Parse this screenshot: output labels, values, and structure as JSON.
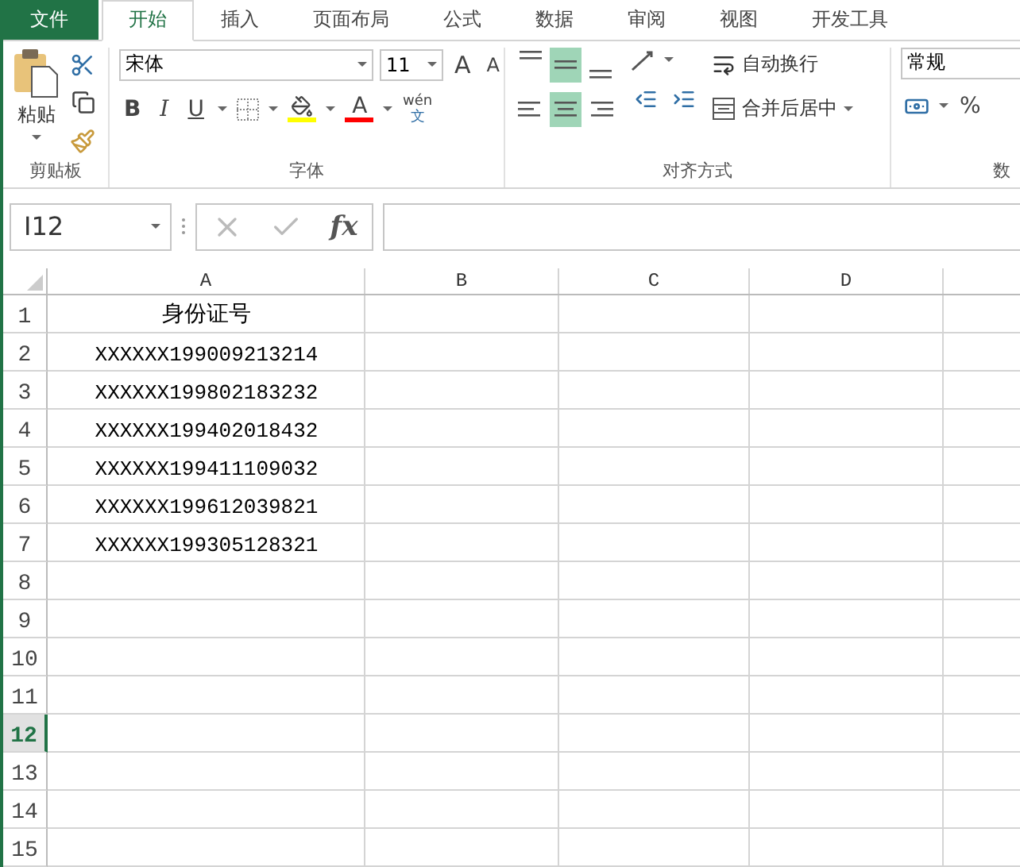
{
  "tabs": [
    {
      "label": "文件",
      "kind": "file",
      "selected": false
    },
    {
      "label": "开始",
      "kind": "tab",
      "selected": true
    },
    {
      "label": "插入",
      "kind": "tab",
      "selected": false
    },
    {
      "label": "页面布局",
      "kind": "tab",
      "selected": false
    },
    {
      "label": "公式",
      "kind": "tab",
      "selected": false
    },
    {
      "label": "数据",
      "kind": "tab",
      "selected": false
    },
    {
      "label": "审阅",
      "kind": "tab",
      "selected": false
    },
    {
      "label": "视图",
      "kind": "tab",
      "selected": false
    },
    {
      "label": "开发工具",
      "kind": "tab",
      "selected": false
    }
  ],
  "ribbon": {
    "clipboard": {
      "paste_label": "粘贴",
      "group_label": "剪贴板"
    },
    "font": {
      "font_name": "宋体",
      "font_size": "11",
      "grow": "A",
      "shrink": "A",
      "bold": "B",
      "italic": "I",
      "underline": "U",
      "font_color": "A",
      "phonetic_top": "wén",
      "phonetic_bottom": "文",
      "group_label": "字体"
    },
    "alignment": {
      "vertical": [
        {
          "selected": false
        },
        {
          "selected": true
        },
        {
          "selected": false
        }
      ],
      "horizontal": [
        {
          "selected": false
        },
        {
          "selected": true
        },
        {
          "selected": false
        }
      ],
      "wrap_label": "自动换行",
      "merge_label": "合并后居中",
      "group_label": "对齐方式"
    },
    "number": {
      "format": "常规",
      "percent": "%",
      "group_label": "数"
    }
  },
  "formula_bar": {
    "name_box": "I12",
    "function_label": "fx"
  },
  "columns": [
    "A",
    "B",
    "C",
    "D"
  ],
  "rows": [
    {
      "header": "1",
      "selected": false,
      "cell_a": "身份证号"
    },
    {
      "header": "2",
      "selected": false,
      "cell_a": "XXXXXX199009213214"
    },
    {
      "header": "3",
      "selected": false,
      "cell_a": "XXXXXX199802183232"
    },
    {
      "header": "4",
      "selected": false,
      "cell_a": "XXXXXX199402018432"
    },
    {
      "header": "5",
      "selected": false,
      "cell_a": "XXXXXX199411109032"
    },
    {
      "header": "6",
      "selected": false,
      "cell_a": "XXXXXX199612039821"
    },
    {
      "header": "7",
      "selected": false,
      "cell_a": "XXXXXX199305128321"
    },
    {
      "header": "8",
      "selected": false
    },
    {
      "header": "9",
      "selected": false
    },
    {
      "header": "10",
      "selected": false
    },
    {
      "header": "11",
      "selected": false
    },
    {
      "header": "12",
      "selected": true
    },
    {
      "header": "13",
      "selected": false
    },
    {
      "header": "14",
      "selected": false
    },
    {
      "header": "15",
      "selected": false
    }
  ]
}
